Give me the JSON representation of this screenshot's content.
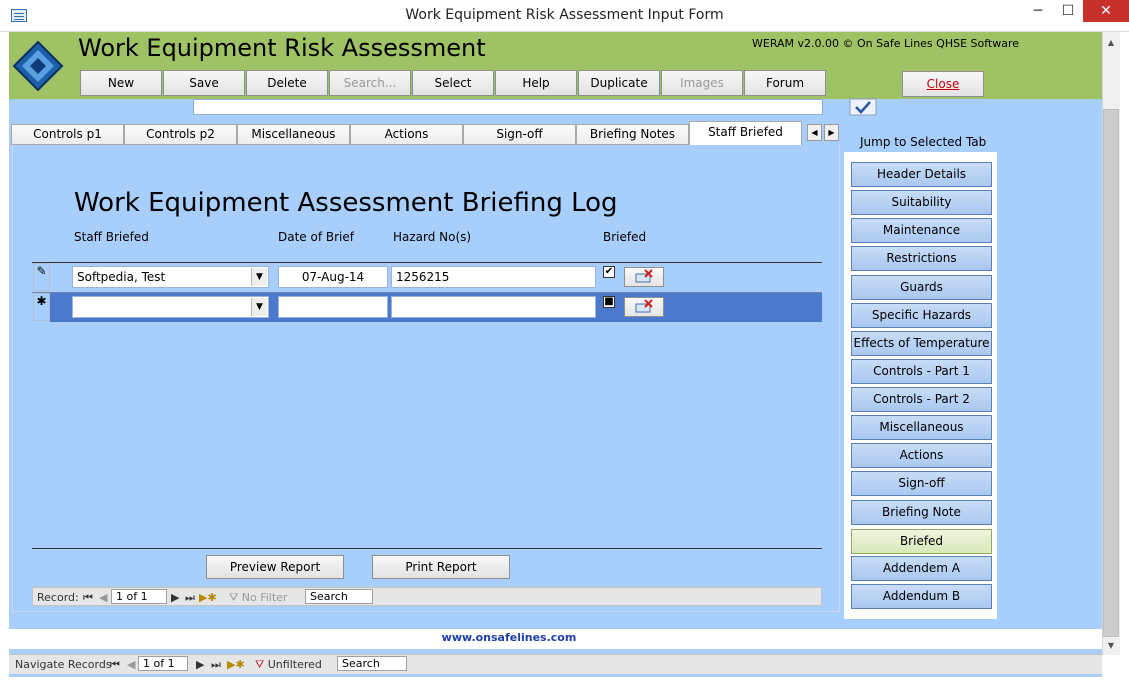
{
  "window": {
    "title": "Work Equipment Risk Assessment Input Form",
    "minimize": "─",
    "maximize": "☐",
    "close": "✕"
  },
  "header": {
    "app_title": "Work Equipment Risk Assessment",
    "version": "WERAM v2.0.00 © On Safe Lines QHSE Software"
  },
  "toolbar": {
    "new": "New",
    "save": "Save",
    "delete": "Delete",
    "search": "Search...",
    "select": "Select",
    "help": "Help",
    "duplicate": "Duplicate",
    "images": "Images",
    "forum": "Forum",
    "close": "Close"
  },
  "tabs": [
    "Controls p1",
    "Controls p2",
    "Miscellaneous",
    "Actions",
    "Sign-off",
    "Briefing Notes",
    "Staff Briefed"
  ],
  "tab_nav": {
    "prev": "◀",
    "next": "▶"
  },
  "briefing": {
    "title": "Work Equipment Assessment Briefing Log",
    "columns": {
      "staff": "Staff Briefed",
      "date": "Date of Brief",
      "hazard": "Hazard No(s)",
      "briefed": "Briefed"
    },
    "rows": [
      {
        "selector": "✎",
        "staff": "Softpedia, Test",
        "date": "07-Aug-14",
        "hazard": "1256215",
        "briefed": "✔"
      },
      {
        "selector": "✱",
        "staff": "",
        "date": "",
        "hazard": "",
        "briefed": "■"
      }
    ]
  },
  "report_buttons": {
    "preview": "Preview Report",
    "print": "Print Report"
  },
  "inner_nav": {
    "label": "Record:",
    "position": "1 of 1",
    "filter": "No Filter",
    "search": "Search"
  },
  "jump": {
    "label": "Jump to Selected Tab",
    "buttons": [
      "Header Details",
      "Suitability",
      "Maintenance",
      "Restrictions",
      "Guards",
      "Specific Hazards",
      "Effects of Temperature",
      "Controls - Part 1",
      "Controls - Part 2",
      "Miscellaneous",
      "Actions",
      "Sign-off",
      "Briefing Note",
      "Briefed",
      "Addendem A",
      "Addendum B"
    ],
    "active": "Briefed"
  },
  "footer": {
    "link": "www.onsafelines.com"
  },
  "outer_nav": {
    "label": "Navigate Records",
    "position": "1 of 1",
    "filter": "Unfiltered",
    "search": "Search"
  },
  "nav_icons": {
    "first": "⏮",
    "prev": "◀",
    "next": "▶",
    "last": "⏭",
    "new": "▶✱"
  }
}
